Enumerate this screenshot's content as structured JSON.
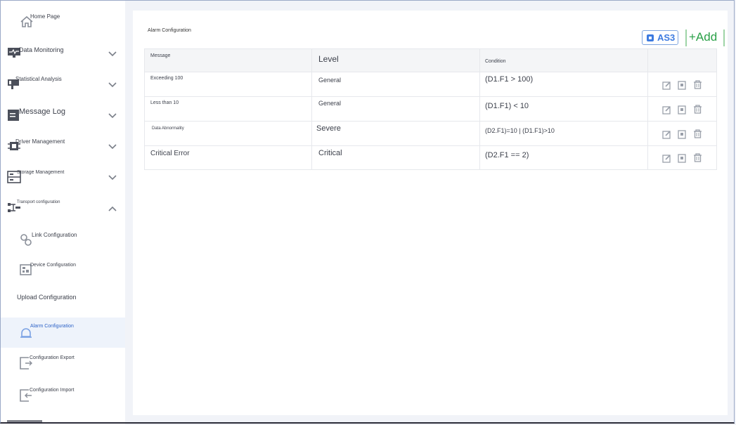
{
  "sidebar": {
    "items": [
      {
        "label": "Home Page",
        "icon": "home-icon"
      },
      {
        "label": "Data Monitoring",
        "icon": "monitor-icon"
      },
      {
        "label": "Statistical Analysis",
        "icon": "chart-icon"
      },
      {
        "label": "Message Log",
        "icon": "message-icon"
      },
      {
        "label": "Driver Management",
        "icon": "chip-icon"
      },
      {
        "label": "Storage Management",
        "icon": "storage-icon"
      },
      {
        "label": "Transport configuration",
        "icon": "transport-icon"
      },
      {
        "label": "Link Configuration",
        "icon": "link-icon"
      },
      {
        "label": "Device Configuration",
        "icon": "device-icon"
      },
      {
        "label": "Upload Configuration"
      },
      {
        "label": "Alarm Configuration",
        "icon": "alarm-icon"
      },
      {
        "label": "Configuration Export",
        "icon": "export-icon"
      },
      {
        "label": "Configuration Import",
        "icon": "import-icon"
      }
    ]
  },
  "main": {
    "title": "Alarm Configuration",
    "as3_label": "AS3",
    "add_label": "+Add",
    "table": {
      "headers": [
        "Message",
        "Level",
        "Condition"
      ],
      "rows": [
        {
          "message": "Exceeding 100",
          "level": "General",
          "condition": "(D1.F1 > 100)"
        },
        {
          "message": "Less than 10",
          "level": "General",
          "condition": "(D1.F1) < 10"
        },
        {
          "message": "Data Abnormality",
          "level": "Severe",
          "condition": "(D2.F1)=10 | (D1.F1)>10"
        },
        {
          "message": "Critical Error",
          "level": "Critical",
          "condition": "(D2.F1 == 2)"
        }
      ]
    }
  },
  "colors": {
    "accent_blue": "#3d7be0",
    "add_green": "#29a047",
    "active_bg": "#eef3fb",
    "main_bg": "#f1f3f8"
  }
}
